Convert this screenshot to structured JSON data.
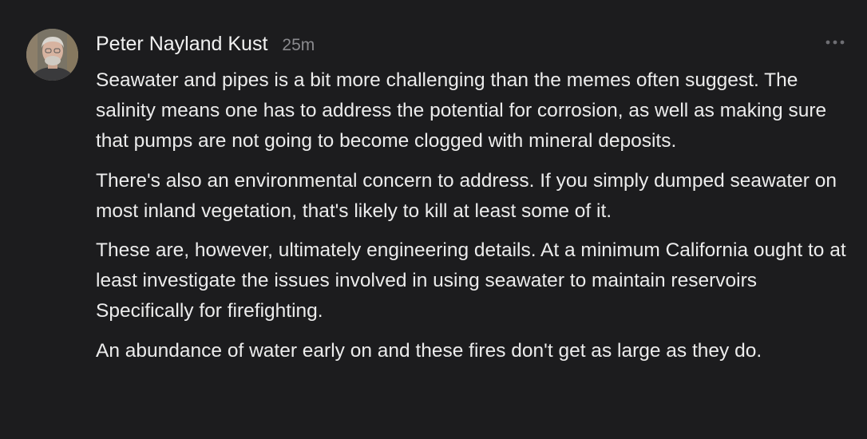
{
  "comment": {
    "author": "Peter Nayland Kust",
    "timestamp": "25m",
    "avatar_icon": "user-photo",
    "more_icon": "more-horizontal-icon",
    "paragraphs": [
      "Seawater and pipes is a bit more challenging than the memes often suggest. The salinity means one has to address the potential for corrosion, as well as making sure that pumps are not going to become clogged with mineral deposits.",
      "There's also an environmental concern to address. If you simply dumped seawater on most inland vegetation, that's likely to kill at least some of it.",
      "These are, however, ultimately engineering details. At a minimum California ought to at least investigate the issues involved in using seawater to maintain reservoirs Specifically for firefighting.",
      "An abundance of water early on and these fires don't get as large as they do."
    ]
  },
  "colors": {
    "background": "#1c1c1e",
    "text": "#ececec",
    "muted": "#8a8a8e"
  }
}
